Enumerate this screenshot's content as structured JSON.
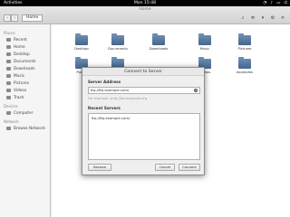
{
  "topbar": {
    "activities": "Activities",
    "clock": "Mon 15:48",
    "tray_icons": [
      "network-icon",
      "volume-icon",
      "battery-icon",
      "power-icon"
    ]
  },
  "window": {
    "title": "Home",
    "path": "Home"
  },
  "sidebar": {
    "places_header": "Places",
    "places": [
      "Recent",
      "Home",
      "Desktop",
      "Documents",
      "Downloads",
      "Music",
      "Pictures",
      "Videos",
      "Trash"
    ],
    "devices_header": "Devices",
    "devices": [
      "Computer"
    ],
    "network_header": "Network",
    "network": [
      "Browse Network"
    ]
  },
  "folders": [
    "Desktop",
    "Documents",
    "Downloads",
    "Music",
    "Pictures",
    "Public",
    "Templates",
    "Videos",
    "examples"
  ],
  "dialog": {
    "title": "Connect to Server",
    "server_address_label": "Server Address",
    "server_address_value": "ftp://ftp.example.com/",
    "hint": "For example, smb://foo.example.org",
    "recent_label": "Recent Servers",
    "recent_servers": [
      "ftp://ftp.example.com/"
    ],
    "browse_label": "Browse",
    "cancel_label": "Cancel",
    "connect_label": "Connect"
  },
  "colors": {
    "topbar": "#000000",
    "folder": "#5a7aa3",
    "sidebar": "#f5f5f5"
  }
}
